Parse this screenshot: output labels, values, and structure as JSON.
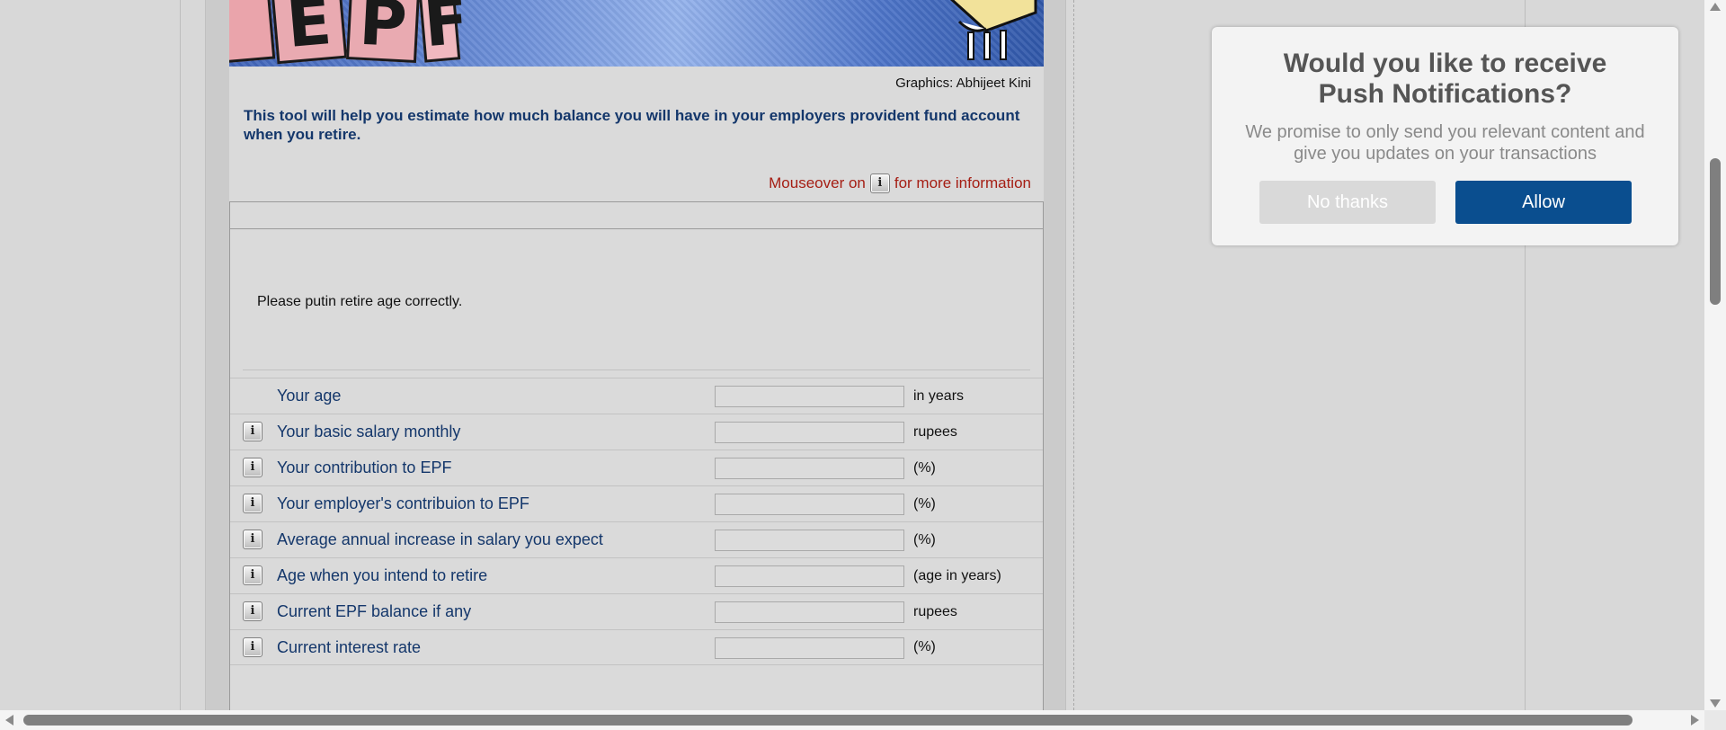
{
  "banner": {
    "letters": [
      "E",
      "P",
      "F"
    ]
  },
  "credit": "Graphics: Abhijeet Kini",
  "intro": "This tool will help you estimate how much balance you will have in your employers provident fund account when you retire.",
  "hint": {
    "before": "Mouseover on",
    "after": "for more information"
  },
  "info_glyph": "i",
  "error_message": "Please putin retire age correctly.",
  "rows": [
    {
      "label": "Your age",
      "unit": "in years",
      "value": "",
      "has_info": false
    },
    {
      "label": "Your basic salary monthly",
      "unit": "rupees",
      "value": "",
      "has_info": true
    },
    {
      "label": "Your contribution to EPF",
      "unit": "(%)",
      "value": "",
      "has_info": true
    },
    {
      "label": "Your employer's contribuion to EPF",
      "unit": "(%)",
      "value": "",
      "has_info": true
    },
    {
      "label": "Average annual increase in salary you expect",
      "unit": "(%)",
      "value": "",
      "has_info": true
    },
    {
      "label": "Age when you intend to retire",
      "unit": "(age in years)",
      "value": "",
      "has_info": true
    },
    {
      "label": "Current EPF balance if any",
      "unit": "rupees",
      "value": "",
      "has_info": true
    },
    {
      "label": "Current interest rate",
      "unit": "(%)",
      "value": "",
      "has_info": true
    }
  ],
  "push": {
    "title": "Would you like to receive Push Notifications?",
    "message": "We promise to only send you relevant content and give you updates on your transactions",
    "no_label": "No thanks",
    "allow_label": "Allow",
    "allow_color": "#0a4e8f"
  }
}
